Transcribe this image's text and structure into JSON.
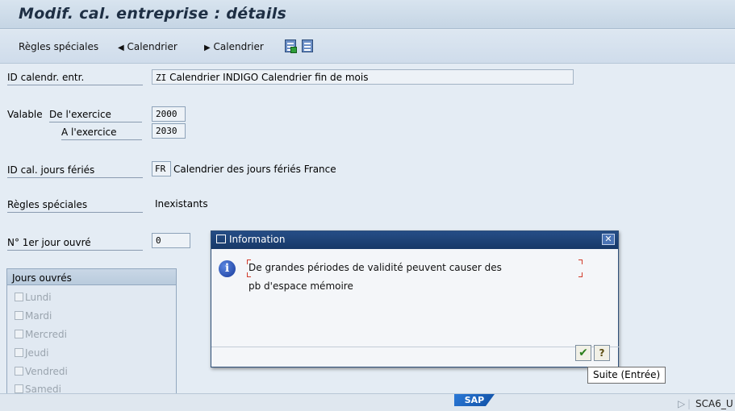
{
  "window": {
    "title": "Modif. cal. entreprise : détails"
  },
  "toolbar": {
    "special_rules": "Règles spéciales",
    "prev_calendar": "Calendrier",
    "next_calendar": "Calendrier",
    "prev_arrow": "◀",
    "next_arrow": "▶"
  },
  "form": {
    "calendar_id_label": "ID calendr. entr.",
    "calendar_id_code": "ZI",
    "calendar_id_text": "Calendrier INDIGO Calendrier fin de mois",
    "valid_label": "Valable",
    "from_year_label": "De l'exercice",
    "from_year": "2000",
    "to_year_label": "A l'exercice",
    "to_year": "2030",
    "holiday_cal_label": "ID cal. jours fériés",
    "holiday_cal_code": "FR",
    "holiday_cal_text": "Calendrier des jours fériés France",
    "special_rules_label": "Règles spéciales",
    "special_rules_value": "Inexistants",
    "first_workday_label": "N° 1er jour ouvré",
    "first_workday_value": "0"
  },
  "workdays": {
    "title": "Jours ouvrés",
    "days": [
      "Lundi",
      "Mardi",
      "Mercredi",
      "Jeudi",
      "Vendredi",
      "Samedi"
    ]
  },
  "dialog": {
    "title": "Information",
    "message_line1": "De grandes périodes de validité peuvent causer des",
    "message_line2": "pb d'espace mémoire",
    "close_glyph": "✕",
    "ok_glyph": "✔",
    "help_glyph": "?"
  },
  "tooltip": {
    "text": "Suite   (Entrée)"
  },
  "status": {
    "logo": "SAP",
    "system": "SCA6_U",
    "arrow": "▷"
  },
  "colors": {
    "dialog_title_bg": "#173867",
    "accent_red": "#d23a2a"
  }
}
